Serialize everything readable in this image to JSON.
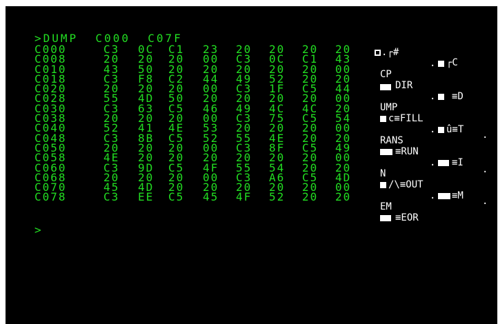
{
  "command": ">DUMP  C000  C07F",
  "prompt": ">",
  "dump_rows": [
    {
      "addr": "C000",
      "bytes": [
        "C3",
        "0C",
        "C1",
        "23",
        "20",
        "20",
        "20",
        "20"
      ]
    },
    {
      "addr": "C008",
      "bytes": [
        "20",
        "20",
        "20",
        "00",
        "C3",
        "0C",
        "C1",
        "43"
      ]
    },
    {
      "addr": "C010",
      "bytes": [
        "43",
        "50",
        "20",
        "20",
        "20",
        "20",
        "20",
        "00"
      ]
    },
    {
      "addr": "C018",
      "bytes": [
        "C3",
        "F8",
        "C2",
        "44",
        "49",
        "52",
        "20",
        "20"
      ]
    },
    {
      "addr": "C020",
      "bytes": [
        "20",
        "20",
        "20",
        "00",
        "C3",
        "1F",
        "C5",
        "44"
      ]
    },
    {
      "addr": "C028",
      "bytes": [
        "55",
        "4D",
        "50",
        "20",
        "20",
        "20",
        "20",
        "00"
      ]
    },
    {
      "addr": "C030",
      "bytes": [
        "C3",
        "63",
        "C5",
        "46",
        "49",
        "4C",
        "4C",
        "20"
      ]
    },
    {
      "addr": "C038",
      "bytes": [
        "20",
        "20",
        "20",
        "00",
        "C3",
        "75",
        "C5",
        "54"
      ]
    },
    {
      "addr": "C040",
      "bytes": [
        "52",
        "41",
        "4E",
        "53",
        "20",
        "20",
        "20",
        "00"
      ]
    },
    {
      "addr": "C048",
      "bytes": [
        "C3",
        "8B",
        "C5",
        "52",
        "55",
        "4E",
        "20",
        "20"
      ]
    },
    {
      "addr": "C050",
      "bytes": [
        "20",
        "20",
        "20",
        "00",
        "C3",
        "8F",
        "C5",
        "49"
      ]
    },
    {
      "addr": "C058",
      "bytes": [
        "4E",
        "20",
        "20",
        "20",
        "20",
        "20",
        "20",
        "00"
      ]
    },
    {
      "addr": "C060",
      "bytes": [
        "C3",
        "9D",
        "C5",
        "4F",
        "55",
        "54",
        "20",
        "20"
      ]
    },
    {
      "addr": "C068",
      "bytes": [
        "20",
        "20",
        "20",
        "00",
        "C3",
        "A6",
        "C5",
        "4D"
      ]
    },
    {
      "addr": "C070",
      "bytes": [
        "45",
        "4D",
        "20",
        "20",
        "20",
        "20",
        "20",
        "00"
      ]
    },
    {
      "addr": "C078",
      "bytes": [
        "C3",
        "EE",
        "C5",
        "45",
        "4F",
        "52",
        "20",
        "20"
      ]
    }
  ],
  "side_panel": {
    "t1": ".┌#",
    "t2": ".",
    "t3": "┌C",
    "t4": "CP",
    "t5": "DIR",
    "t6": ".",
    "t7": "≡D",
    "t8": "UMP",
    "t9": "c≡FILL",
    "t10": ".",
    "t11": "û≡T",
    "t12": "RANS",
    "t13": "≡RUN",
    "t14": ".",
    "t15": "≡I",
    "t16": "N",
    "t17": "/\\≡OUT",
    "t18": ".",
    "t19": "≡M",
    "t20": "EM",
    "t21": "≡EOR",
    "t22": ".",
    "t23": ".",
    "t24": "."
  },
  "colors": {
    "screen_bg": "#000000",
    "text_green": "#22dd22",
    "text_white": "#ffffff"
  }
}
